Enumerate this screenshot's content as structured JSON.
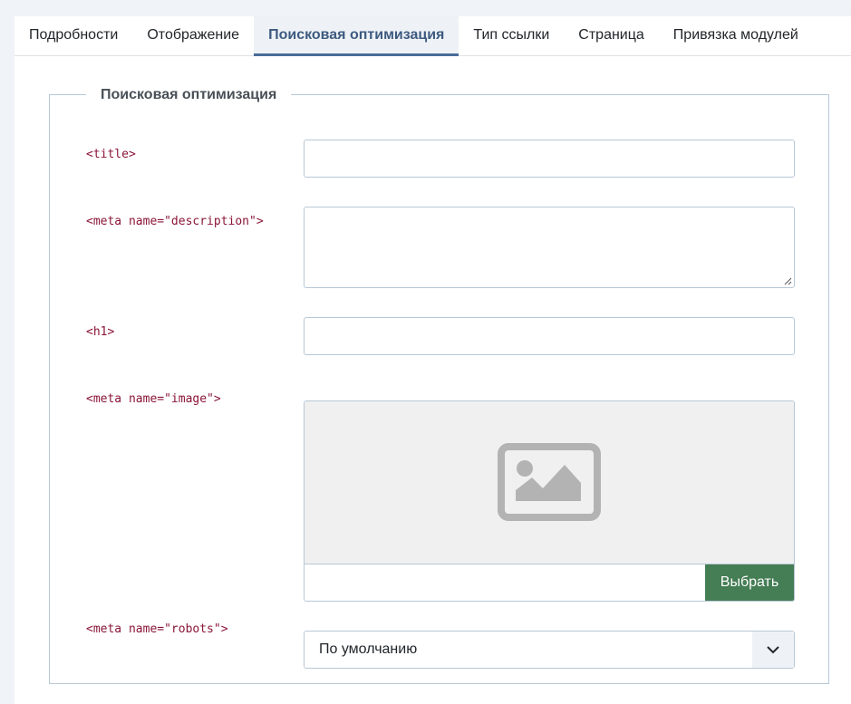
{
  "tabs": [
    {
      "label": "Подробности"
    },
    {
      "label": "Отображение"
    },
    {
      "label": "Поисковая оптимизация",
      "active": true
    },
    {
      "label": "Тип ссылки"
    },
    {
      "label": "Страница"
    },
    {
      "label": "Привязка модулей"
    }
  ],
  "fieldset": {
    "legend": "Поисковая оптимизация",
    "fields": {
      "title": {
        "label": "<title>",
        "value": ""
      },
      "description": {
        "label": "<meta name=\"description\">",
        "value": ""
      },
      "h1": {
        "label": "<h1>",
        "value": ""
      },
      "image": {
        "label": "<meta name=\"image\">",
        "value": "",
        "button_label": "Выбрать",
        "preview_icon": "image-placeholder-icon"
      },
      "robots": {
        "label": "<meta name=\"robots\">",
        "selected": "По умолчанию",
        "icon": "chevron-down-icon"
      }
    }
  },
  "colors": {
    "accent": "#3d5a80",
    "tab_underline": "#4a6b99",
    "label_code": "#8a1538",
    "button_green": "#457d54",
    "border": "#b8c8d6"
  }
}
